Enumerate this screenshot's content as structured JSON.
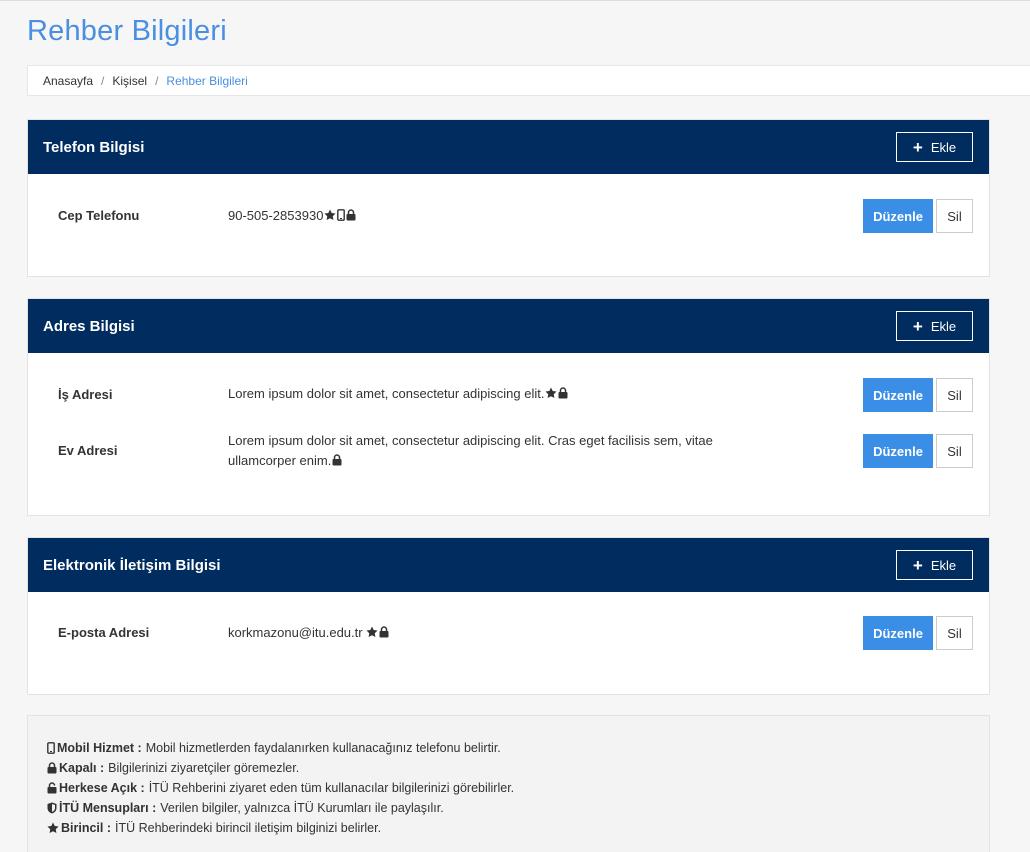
{
  "page": {
    "title": "Rehber Bilgileri"
  },
  "breadcrumb": {
    "items": [
      "Anasayfa",
      "Kişisel",
      "Rehber Bilgileri"
    ]
  },
  "colors": {
    "header": "#002c5f",
    "accent": "#4a8fe0",
    "edit_button": "#3a8ee6"
  },
  "buttons": {
    "add": "Ekle",
    "edit": "Düzenle",
    "delete": "Sil"
  },
  "phone_panel": {
    "title": "Telefon Bilgisi",
    "rows": [
      {
        "label": "Cep Telefonu",
        "value": "90-505-2853930",
        "icons": [
          "star-icon",
          "mobile-icon",
          "lock-icon"
        ]
      }
    ]
  },
  "address_panel": {
    "title": "Adres Bilgisi",
    "rows": [
      {
        "label": "İş Adresi",
        "value": "Lorem ipsum dolor sit amet, consectetur adipiscing elit.",
        "icons": [
          "star-icon",
          "lock-icon"
        ]
      },
      {
        "label": "Ev Adresi",
        "value_line1": "Lorem ipsum dolor sit amet, consectetur adipiscing elit. Cras eget facilisis sem, vitae",
        "value_line2": "ullamcorper enim.",
        "icons": [
          "lock-icon"
        ]
      }
    ]
  },
  "email_panel": {
    "title": "Elektronik İletişim Bilgisi",
    "rows": [
      {
        "label": "E-posta Adresi",
        "value": "korkmazonu@itu.edu.tr",
        "icons": [
          "star-icon",
          "lock-icon"
        ]
      }
    ]
  },
  "legend": [
    {
      "icon": "mobile-icon",
      "term": "Mobil Hizmet :",
      "desc": "Mobil hizmetlerden faydalanırken kullanacağınız telefonu belirtir."
    },
    {
      "icon": "lock-icon",
      "term": "Kapalı :",
      "desc": "Bilgilerinizi ziyaretçiler göremezler."
    },
    {
      "icon": "unlock-icon",
      "term": "Herkese Açık :",
      "desc": "İTÜ Rehberini ziyaret eden tüm kullanacılar bilgilerinizi görebilirler."
    },
    {
      "icon": "shield-icon",
      "term": "İTÜ Mensupları :",
      "desc": "Verilen bilgiler, yalnızca İTÜ Kurumları ile paylaşılır."
    },
    {
      "icon": "star-icon",
      "term": "Birincil :",
      "desc": "İTÜ Rehberindeki birincil iletişim bilgini​zi belirler."
    }
  ]
}
